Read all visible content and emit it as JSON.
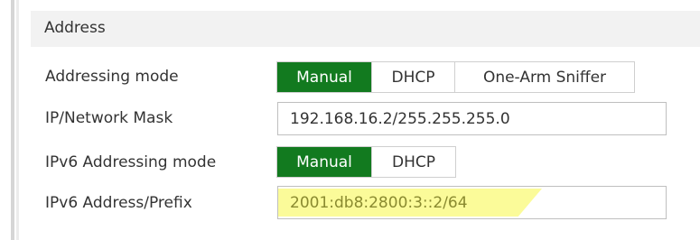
{
  "section": {
    "title": "Address"
  },
  "addressing_mode": {
    "label": "Addressing mode",
    "options": [
      "Manual",
      "DHCP",
      "One-Arm Sniffer"
    ],
    "selected": "Manual"
  },
  "ip_mask": {
    "label": "IP/Network Mask",
    "value": "192.168.16.2/255.255.255.0"
  },
  "ipv6_addressing_mode": {
    "label": "IPv6 Addressing mode",
    "options": [
      "Manual",
      "DHCP"
    ],
    "selected": "Manual"
  },
  "ipv6_address": {
    "label": "IPv6 Address/Prefix",
    "value": "2001:db8:2800:3::2/64"
  },
  "colors": {
    "active_segment": "#127a1f",
    "highlight": "#fbfb99"
  }
}
